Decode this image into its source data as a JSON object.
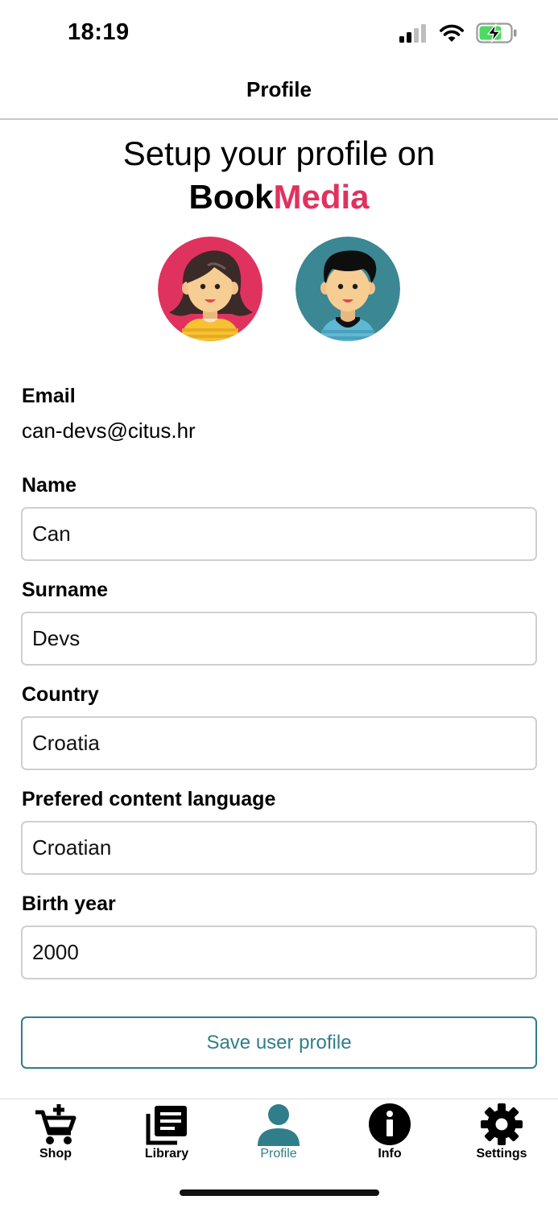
{
  "status_bar": {
    "time": "18:19",
    "signal_icon": "cellular-signal-icon",
    "wifi_icon": "wifi-icon",
    "battery_icon": "battery-charging-icon"
  },
  "nav": {
    "title": "Profile"
  },
  "headline": {
    "line1": "Setup your profile on",
    "brand_part1": "Book",
    "brand_part2": "Media"
  },
  "avatars": [
    {
      "name": "female-avatar-icon"
    },
    {
      "name": "male-avatar-icon"
    }
  ],
  "profile": {
    "email_label": "Email",
    "email_value": "can-devs@citus.hr",
    "name_label": "Name",
    "name_value": "Can",
    "surname_label": "Surname",
    "surname_value": "Devs",
    "country_label": "Country",
    "country_value": "Croatia",
    "language_label": "Prefered content language",
    "language_value": "Croatian",
    "birth_year_label": "Birth year",
    "birth_year_value": "2000",
    "save_label": "Save user profile"
  },
  "tabs": [
    {
      "label": "Shop",
      "icon": "cart-plus-icon"
    },
    {
      "label": "Library",
      "icon": "library-icon"
    },
    {
      "label": "Profile",
      "icon": "person-icon",
      "active": true
    },
    {
      "label": "Info",
      "icon": "info-icon"
    },
    {
      "label": "Settings",
      "icon": "gear-icon"
    }
  ],
  "colors": {
    "accent": "#2f7e8a",
    "brand_pink": "#e0325f",
    "female_avatar_bg": "#e0325f",
    "male_avatar_bg": "#3b8793"
  }
}
